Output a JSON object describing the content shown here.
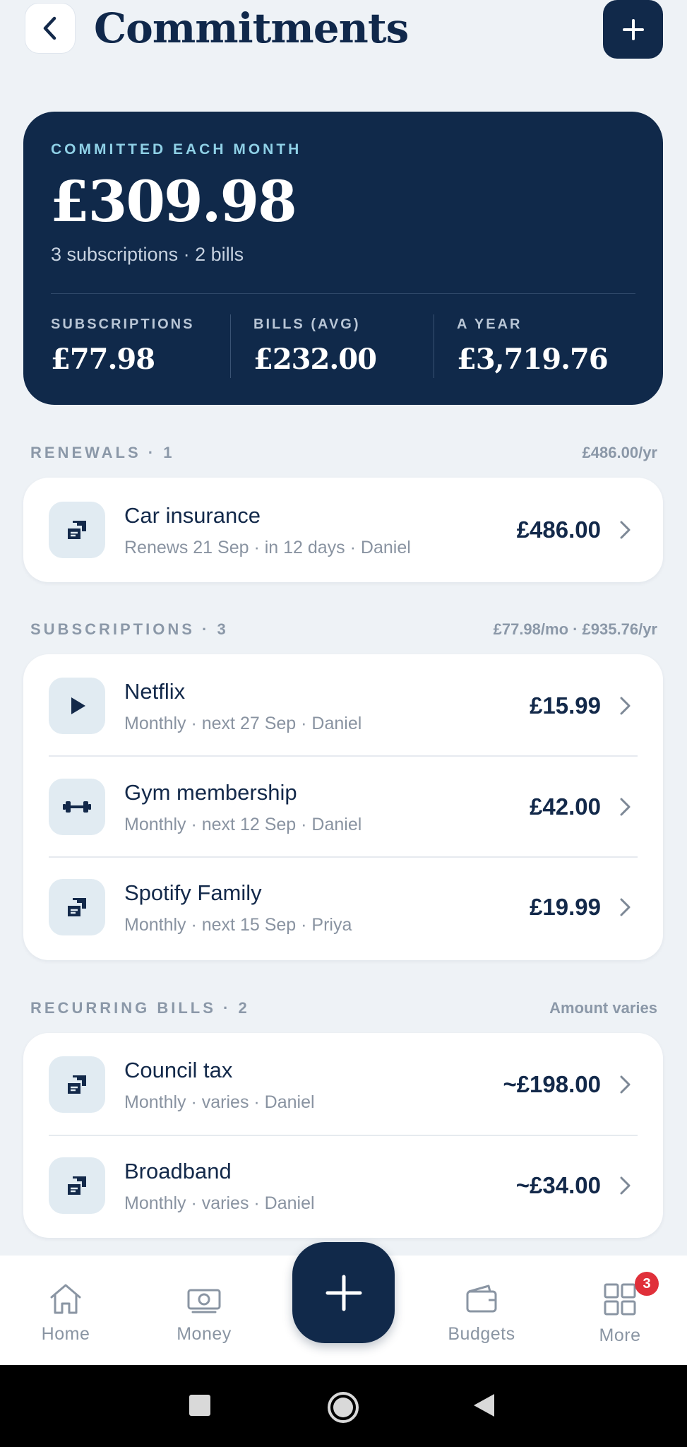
{
  "header": {
    "title": "Commitments"
  },
  "summary": {
    "eyebrow": "COMMITTED EACH MONTH",
    "total": "£309.98",
    "counts": "3 subscriptions · 2 bills",
    "stats": [
      {
        "label": "SUBSCRIPTIONS",
        "value": "£77.98"
      },
      {
        "label": "BILLS (AVG)",
        "value": "£232.00"
      },
      {
        "label": "A YEAR",
        "value": "£3,719.76"
      }
    ]
  },
  "renewals": {
    "title": "RENEWALS · 1",
    "meta": "£486.00/yr",
    "items": [
      {
        "name": "Car insurance",
        "sub": "Renews 21 Sep · in 12 days · Daniel",
        "amount": "£486.00",
        "icon": "receipt-icon"
      }
    ]
  },
  "subscriptions": {
    "title": "SUBSCRIPTIONS · 3",
    "meta": "£77.98/mo · £935.76/yr",
    "items": [
      {
        "name": "Netflix",
        "sub": "Monthly · next 27 Sep · Daniel",
        "amount": "£15.99",
        "icon": "play-icon"
      },
      {
        "name": "Gym membership",
        "sub": "Monthly · next 12 Sep · Daniel",
        "amount": "£42.00",
        "icon": "dumbbell-icon"
      },
      {
        "name": "Spotify Family",
        "sub": "Monthly · next 15 Sep · Priya",
        "amount": "£19.99",
        "icon": "receipt-icon"
      }
    ]
  },
  "bills": {
    "title": "RECURRING BILLS · 2",
    "meta": "Amount varies",
    "items": [
      {
        "name": "Council tax",
        "sub": "Monthly · varies · Daniel",
        "amount": "~£198.00",
        "icon": "receipt-icon"
      },
      {
        "name": "Broadband",
        "sub": "Monthly · varies · Daniel",
        "amount": "~£34.00",
        "icon": "receipt-icon"
      }
    ]
  },
  "nav": {
    "home": "Home",
    "money": "Money",
    "budgets": "Budgets",
    "more": "More",
    "more_badge": "3"
  },
  "colors": {
    "navy": "#10294a",
    "accent_eyebrow": "#8fd0e6",
    "background": "#eef2f6",
    "badge": "#e0303a"
  }
}
